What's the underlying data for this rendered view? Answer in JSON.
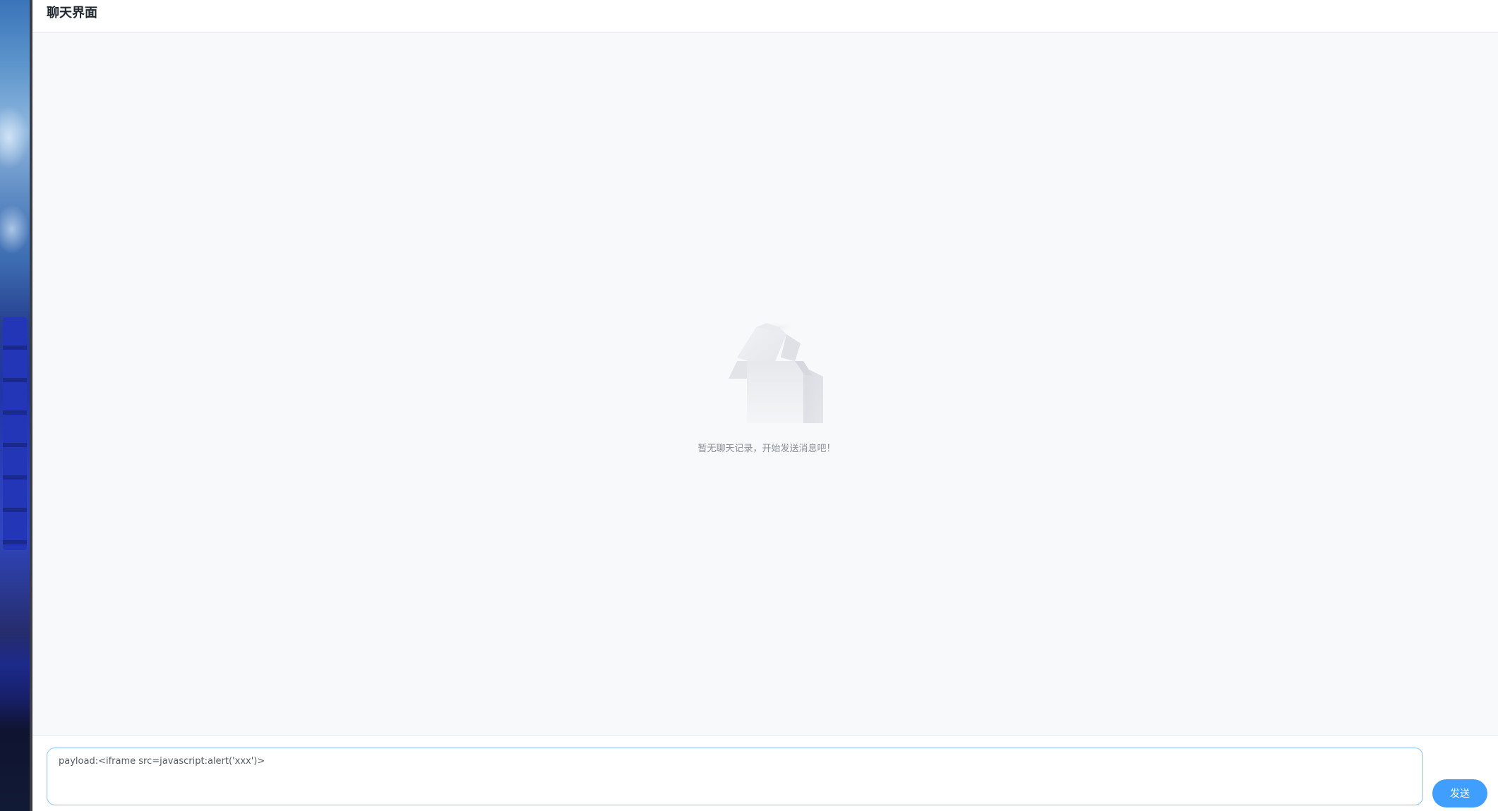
{
  "header": {
    "title": "聊天界面"
  },
  "messages": {
    "empty_text": "暂无聊天记录，开始发送消息吧！",
    "empty_icon": "empty-box-icon"
  },
  "composer": {
    "input_value": "payload:<iframe src=javascript:alert('xxx')>",
    "send_label": "发送"
  },
  "colors": {
    "accent": "#409eff",
    "input_border": "#8cc3f2",
    "background": "#f8f9fb"
  }
}
